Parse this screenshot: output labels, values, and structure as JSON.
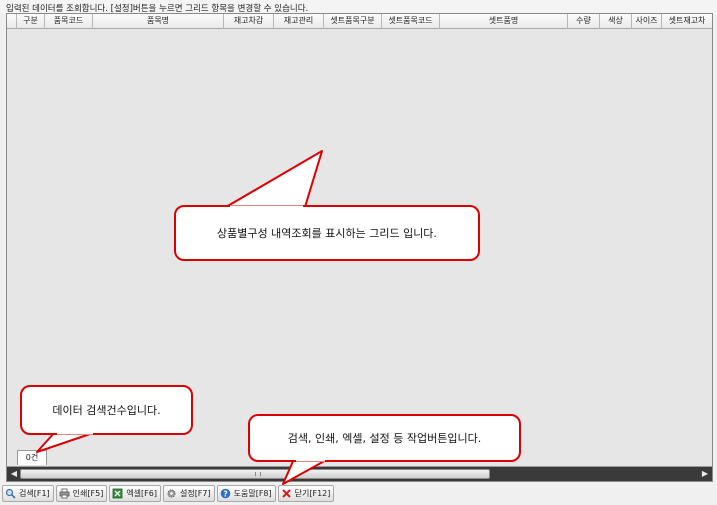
{
  "info_message": "입력된 데이터를 조회합니다. [설정]버튼을 누르면 그리드 항목을 변경할 수 있습니다.",
  "grid": {
    "columns": [
      "",
      "구분",
      "품목코드",
      "품목명",
      "재고차감",
      "재고관리",
      "셋트품목구분",
      "셋트품목코드",
      "셋트품명",
      "수량",
      "색상",
      "사이즈",
      "셋트재고차"
    ],
    "count_label": "0건"
  },
  "callouts": {
    "grid": "상품별구성 내역조회를 표시하는 그리드 입니다.",
    "count": "데이터 검색건수입니다.",
    "buttons": "검색, 인쇄, 엑셀, 설정 등 작업버튼입니다."
  },
  "toolbar": {
    "search": "검색[F1]",
    "print": "인쇄[F5]",
    "excel": "엑셀[F6]",
    "settings": "설정[F7]",
    "help": "도움말[F8]",
    "close": "닫기[F12]"
  },
  "colors": {
    "callout_border": "#dd0000",
    "grid_bg": "#e6e6e6",
    "scrollbar_track": "#3a3a3a"
  },
  "icons": {
    "search": "magnifier-icon",
    "print": "printer-icon",
    "excel": "excel-icon",
    "settings": "gear-icon",
    "help": "question-icon",
    "close": "close-x-icon"
  }
}
